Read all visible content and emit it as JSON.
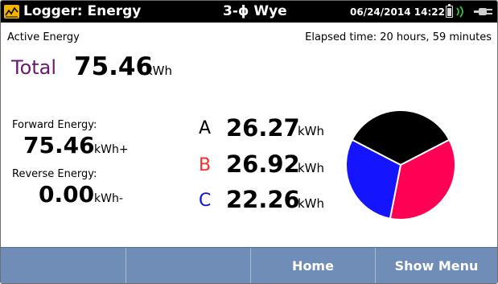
{
  "header": {
    "title": "Logger: Energy",
    "mode": "3-ϕ Wye",
    "datetime": "06/24/2014 14:22",
    "icons": [
      "logger-app-icon",
      "battery-icon",
      "wireless-icon",
      "plug-icon"
    ]
  },
  "energy": {
    "section_label": "Active Energy",
    "elapsed": "Elapsed time: 20 hours, 59 minutes",
    "total_label": "Total",
    "total_value": "75.46",
    "total_unit": "kWh",
    "forward_label": "Forward Energy:",
    "forward_value": "75.46",
    "forward_unit": "kWh+",
    "reverse_label": "Reverse Energy:",
    "reverse_value": "0.00",
    "reverse_unit": "kWh-",
    "phases": [
      {
        "letter": "A",
        "value": "26.27",
        "unit": "kWh",
        "color": "#000000"
      },
      {
        "letter": "B",
        "value": "26.92",
        "unit": "kWh",
        "color": "#ff2a2a"
      },
      {
        "letter": "C",
        "value": "22.26",
        "unit": "kWh",
        "color": "#1010e0"
      }
    ]
  },
  "chart_data": {
    "type": "pie",
    "categories": [
      "A",
      "B",
      "C"
    ],
    "values": [
      26.27,
      26.92,
      22.26
    ],
    "colors": [
      "#000000",
      "#ff0055",
      "#1414ff"
    ]
  },
  "footer": {
    "keys": [
      "",
      "",
      "Home",
      "Show Menu"
    ]
  },
  "colors": {
    "title_bar": "#000000",
    "function_bar": "#6f8db7",
    "total_label": "#6a1a6e",
    "app_icon": "#f2b400"
  }
}
